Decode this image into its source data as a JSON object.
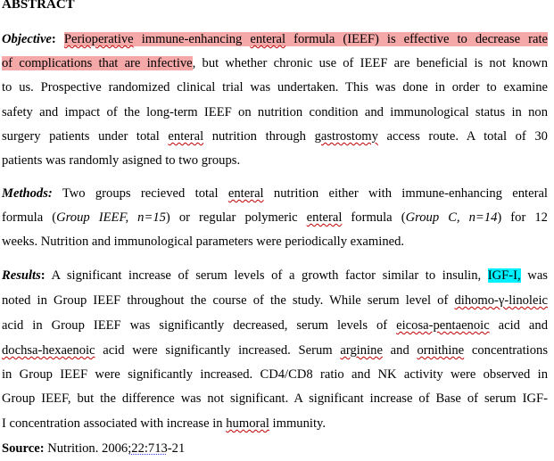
{
  "abstract": {
    "heading": "ABSTRACT",
    "objective": {
      "label": "Objective",
      "colon": ":",
      "lines": [
        {
          "hl_w1": "Perioperative",
          "hl_s1": " immune-enhancing ",
          "hl_w2": "enteral",
          "hl_s2": " formula (IEEF) is effective to decrease rate"
        },
        {
          "hl": "of complications that are infective",
          "rest": ", but whether chronic use of IEEF are beneficial is not known"
        },
        {
          "text": "to us. Prospective randomized clinical trial was undertaken. This was done in order to examine"
        },
        {
          "text": "safety and impact of the long-term IEEF on nutrition condition and immunological  status in non"
        },
        {
          "p1": "surgery patients under total ",
          "w1": "enteral",
          "p2": " nutrition through ",
          "w2": "gastrostomy",
          "p3": " access route. A total of 30"
        },
        {
          "text": "patients was randomly asigned to two  groups."
        }
      ]
    },
    "methods": {
      "label": "Methods:",
      "lines": [
        {
          "p1": " Two groups recieved total ",
          "w1": "enteral",
          "p2": " nutrition either with immune-enhancing  enteral"
        },
        {
          "p1": "formula (",
          "i1": "Group IEEF, n=15",
          "p2": ") or regular polymeric ",
          "w1": "enteral",
          "p3": " formula (",
          "i2": "Group C, n=14",
          "p4": ") for 12"
        },
        {
          "text": "weeks. Nutrition and immunological  parameters were periodically examined."
        }
      ]
    },
    "results": {
      "label": "Results",
      "colon": ":",
      "lines": [
        {
          "p1": " A significant increase of serum levels of a growth factor similar to insulin, ",
          "hl": "IGF-I,",
          "p2": " was"
        },
        {
          "p1": "noted in Group IEEF throughout the course of the study. While serum level of ",
          "w1": "dihomo-γ-linoleic"
        },
        {
          "p1": "acid in Group IEEF was significantly decreased, serum levels of ",
          "w1": "eicosa-pentaenoic",
          "p2": " acid and"
        },
        {
          "w1": "dochsa-hexaenoic",
          "p1": " acid were significantly increased. Serum ",
          "w2": "arginine",
          "p2": " and ",
          "w3": "ornithine",
          "p3": " concentrations"
        },
        {
          "text": "in Group IEEF were significantly increased.  CD4/CD8 ratio and NK activity were observed in"
        },
        {
          "text": "Group IEEF, but the difference was not significant. A significant increase of Base of serum IGF-"
        },
        {
          "p1": "I concentration associated with increase in ",
          "w1": "humoral",
          "p2": " immunity."
        }
      ]
    },
    "source": {
      "label": "Source:",
      "p1": " Nutrition. 2006",
      "w1": ";22:713",
      "p2": "-21"
    }
  }
}
